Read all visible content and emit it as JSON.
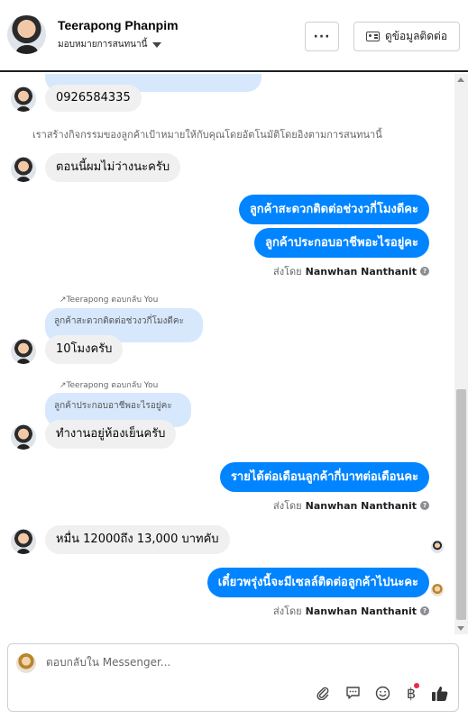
{
  "header": {
    "contact_name": "Teerapong Phanpim",
    "assign_label": "มอบหมายการสนทนานี้",
    "more_label": "···",
    "contact_info_label": "ดูข้อมูลติดต่อ"
  },
  "messages": {
    "phone": "0926584335",
    "system_note": "เราสร้างกิจกรรมของลูกค้าเป้าหมายให้กับคุณโดยอัตโนมัติโดยอิงตามการสนทนานี้",
    "in_1": "ตอนนี้ผมไม่ว่างนะครับ",
    "out_1": "ลูกค้าสะดวกติดต่อช่วงวกี่โมงดีคะ",
    "out_2": "ลูกค้าประกอบอาชีพอะไรอยู่คะ",
    "sent_by_1": "ส่งโดย",
    "sender_1": "Nanwhan Nanthanit",
    "reply_label_1": "Teerapong ตอบกลับ You",
    "quote_1": "ลูกค้าสะดวกติดต่อช่วงวกี่โมงดีคะ",
    "in_2": "10โมงครับ",
    "reply_label_2": "Teerapong ตอบกลับ You",
    "quote_2": "ลูกค้าประกอบอาชีพอะไรอยู่คะ",
    "in_3": "ทำงานอยู่ห้องเย็นครับ",
    "out_3": "รายได้ต่อเดือนลูกค้ากี่บาทต่อเดือนคะ",
    "sent_by_2": "ส่งโดย",
    "sender_2": "Nanwhan Nanthanit",
    "in_4": "หมื่น 12000ถึง 13,000 บาทคับ",
    "out_4": "เดี๋ยวพรุ่งนี้จะมีเซลล์ติดต่อลูกค้าไปนะคะ",
    "sent_by_3": "ส่งโดย",
    "sender_3": "Nanwhan Nanthanit"
  },
  "composer": {
    "placeholder": "ตอบกลับใน Messenger..."
  },
  "icons": {
    "attach": "paperclip-icon",
    "saved_replies": "chat-bubble-icon",
    "emoji": "smiley-icon",
    "payment": "baht-icon",
    "like": "thumbs-up-icon"
  },
  "colors": {
    "outgoing_bubble": "#0084ff",
    "incoming_bubble": "#f0f0f0",
    "quote_bubble": "#d7e8fd",
    "notification_dot": "#f02849"
  }
}
